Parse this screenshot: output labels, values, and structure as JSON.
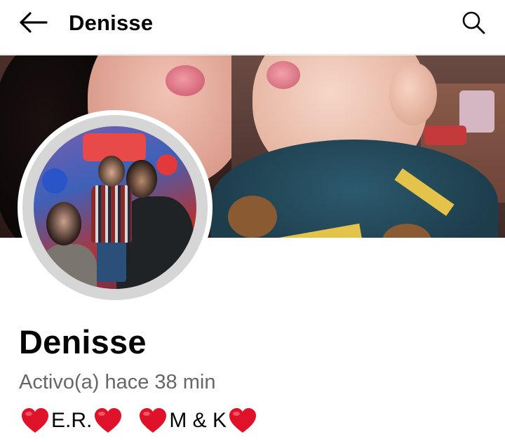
{
  "header": {
    "title": "Denisse",
    "back_icon": "arrow-left-icon",
    "search_icon": "search-icon"
  },
  "profile": {
    "name": "Denisse",
    "status": "Activo(a) hace 38 min",
    "bio_part1": "E.R.",
    "bio_part2": "M & K",
    "bio_emoji": "heart-icon"
  },
  "colors": {
    "heart": "#e0122a",
    "status_text": "#65676b",
    "text": "#050505"
  }
}
